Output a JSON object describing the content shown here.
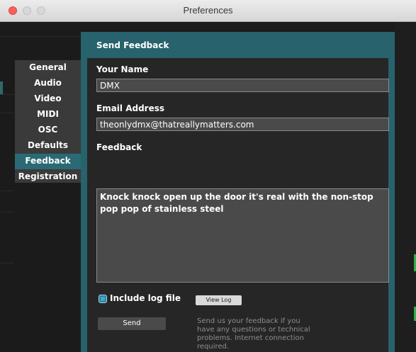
{
  "window": {
    "title": "Preferences"
  },
  "sidebar": {
    "items": [
      {
        "label": "General"
      },
      {
        "label": "Audio"
      },
      {
        "label": "Video"
      },
      {
        "label": "MIDI"
      },
      {
        "label": "OSC"
      },
      {
        "label": "Defaults"
      },
      {
        "label": "Feedback",
        "active": true
      },
      {
        "label": "Registration"
      }
    ]
  },
  "panel": {
    "title": "Send Feedback",
    "name_label": "Your Name",
    "name_value": "DMX",
    "email_label": "Email Address",
    "email_value": "theonlydmx@thatreallymatters.com",
    "feedback_label": "Feedback",
    "feedback_value": "Knock knock open up the door it's real with the non-stop pop pop of stainless steel",
    "include_log_label": "Include log file",
    "include_log_checked": true,
    "view_log_label": "View Log",
    "send_label": "Send",
    "help_text": "Send us your feedback if you have any questions or technical problems. Internet connection required."
  },
  "colors": {
    "accent": "#27626d",
    "active_nav": "#2b6a75",
    "checkbox": "#3fa8c8"
  }
}
